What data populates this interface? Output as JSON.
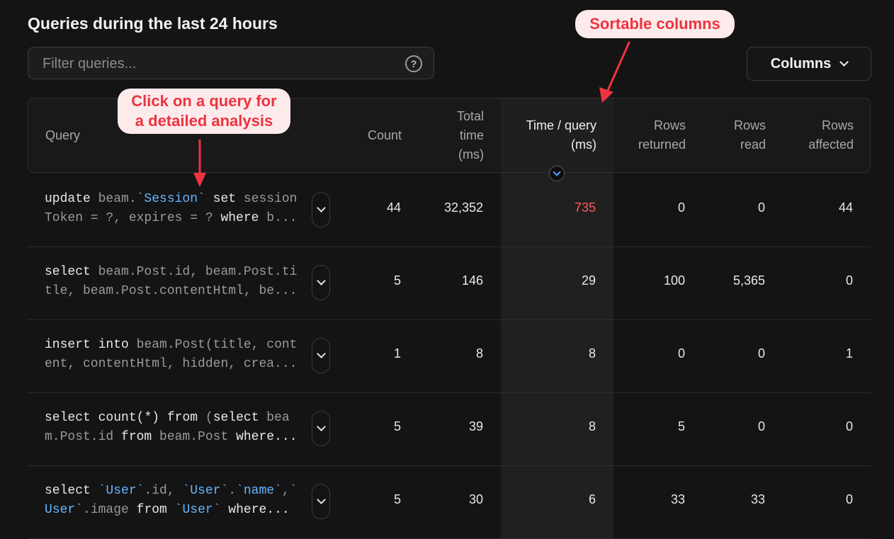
{
  "page": {
    "title": "Queries during the last 24 hours"
  },
  "filter": {
    "placeholder": "Filter queries...",
    "value": ""
  },
  "toolbar": {
    "columns_label": "Columns"
  },
  "table": {
    "headers": {
      "query": "Query",
      "count": "Count",
      "total_time": [
        "Total",
        "time",
        "(ms)"
      ],
      "time_per_query": [
        "Time / query",
        "(ms)"
      ],
      "rows_returned": [
        "Rows",
        "returned"
      ],
      "rows_read": [
        "Rows",
        "read"
      ],
      "rows_affected": [
        "Rows",
        "affected"
      ]
    },
    "sorted_by": "time_per_query",
    "rows": [
      {
        "query": [
          "update",
          " beam.",
          "`Session`",
          " set",
          " session",
          "Token = ?, expires = ? ",
          "where",
          " b..."
        ],
        "count": "44",
        "total_time": "32,352",
        "time_per_query": "735",
        "rows_returned": "0",
        "rows_read": "0",
        "rows_affected": "44"
      },
      {
        "query": [
          "select",
          " beam.Post.id, beam.Post.ti",
          "tle, beam.Post.contentHtml, be..."
        ],
        "count": "5",
        "total_time": "146",
        "time_per_query": "29",
        "rows_returned": "100",
        "rows_read": "5,365",
        "rows_affected": "0"
      },
      {
        "query": [
          "insert",
          " ",
          "into",
          " beam.Post(title, cont",
          "ent, contentHtml, hidden, crea..."
        ],
        "count": "1",
        "total_time": "8",
        "time_per_query": "8",
        "rows_returned": "0",
        "rows_read": "0",
        "rows_affected": "1"
      },
      {
        "query": [
          "select",
          " ",
          "count",
          "(*) ",
          "from",
          " (",
          "select",
          " bea",
          "m.Post.id ",
          "from",
          " beam.Post ",
          "where..."
        ],
        "count": "5",
        "total_time": "39",
        "time_per_query": "8",
        "rows_returned": "5",
        "rows_read": "0",
        "rows_affected": "0"
      },
      {
        "query": [
          "select",
          " ",
          "`User`",
          ".id, ",
          "`User`",
          ".",
          "`name`",
          ",",
          "`User`",
          ".image ",
          "from",
          " ",
          "`User`",
          " ",
          "where..."
        ],
        "count": "5",
        "total_time": "30",
        "time_per_query": "6",
        "rows_returned": "33",
        "rows_read": "33",
        "rows_affected": "0"
      }
    ]
  },
  "annotations": {
    "sortable": "Sortable columns",
    "click_query": [
      "Click on a query for",
      "a detailed analysis"
    ]
  },
  "colors": {
    "background": "#141414",
    "warning": "#ff5b5b",
    "identifier": "#64b4ff",
    "callout_text": "#ee3340",
    "callout_bg": "#fdebec"
  },
  "icons": {
    "help": "help-circle-icon",
    "dropdown": "chevron-down-icon",
    "sort": "sort-desc-icon",
    "expand": "chevron-down-icon"
  }
}
